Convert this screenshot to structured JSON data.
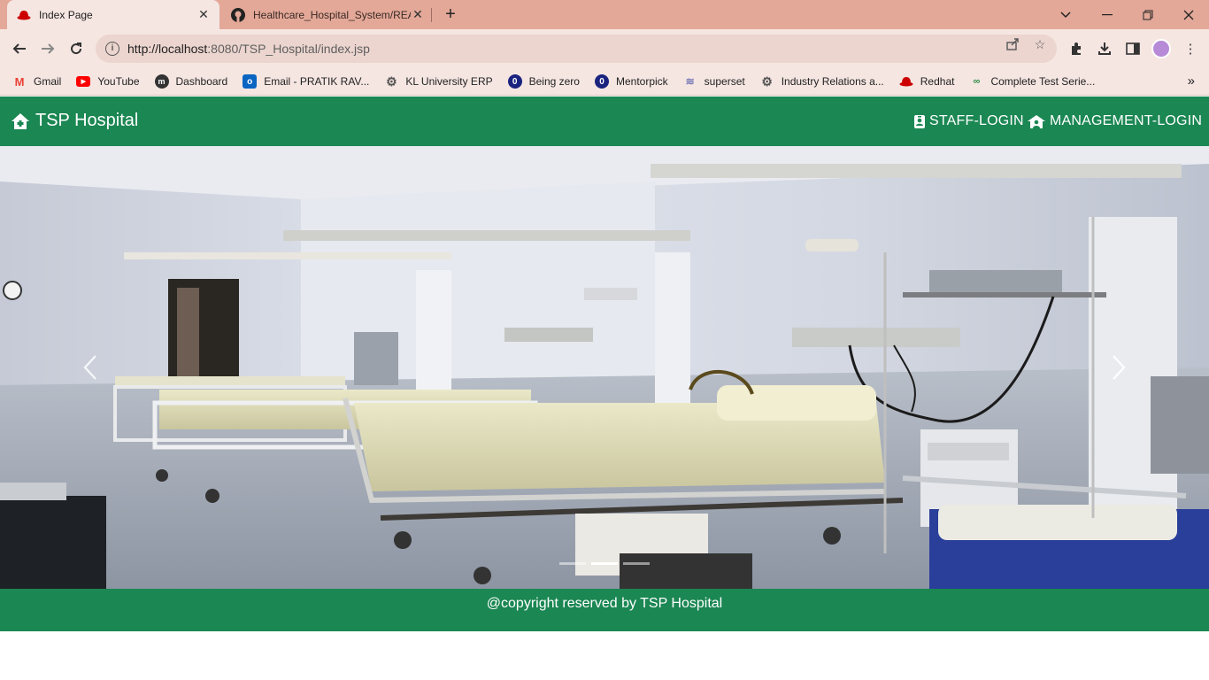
{
  "browser": {
    "tabs": [
      {
        "title": "Index Page",
        "active": true
      },
      {
        "title": "Healthcare_Hospital_System/REA",
        "active": false
      }
    ],
    "url": {
      "host": "http://localhost",
      "rest": ":8080/TSP_Hospital/index.jsp"
    },
    "bookmarks": [
      {
        "label": "Gmail",
        "icon": "gmail-icon",
        "color": "#ea4335"
      },
      {
        "label": "YouTube",
        "icon": "youtube-icon",
        "color": "#ff0000"
      },
      {
        "label": "Dashboard",
        "icon": "dashboard-icon",
        "color": "#333333"
      },
      {
        "label": "Email - PRATIK RAV...",
        "icon": "outlook-icon",
        "color": "#0a64c2"
      },
      {
        "label": "KL University ERP",
        "icon": "gear-icon",
        "color": "#555555"
      },
      {
        "label": "Being zero",
        "icon": "being-zero-icon",
        "color": "#1a237e"
      },
      {
        "label": "Mentorpick",
        "icon": "mentorpick-icon",
        "color": "#1a237e"
      },
      {
        "label": "superset",
        "icon": "superset-icon",
        "color": "#7a7ab8"
      },
      {
        "label": "Industry Relations a...",
        "icon": "gear-icon",
        "color": "#555555"
      },
      {
        "label": "Redhat",
        "icon": "redhat-icon",
        "color": "#cc0000"
      },
      {
        "label": "Complete Test Serie...",
        "icon": "gfg-icon",
        "color": "#2f8d46"
      }
    ]
  },
  "navbar": {
    "brand": "TSP Hospital",
    "links": [
      "STAFF-LOGIN",
      "MANAGEMENT-LOGIN"
    ],
    "color": "#1b8753"
  },
  "carousel": {
    "slide_count": 3,
    "active_index": 1
  },
  "footer": {
    "text": "@copyright reserved by TSP Hospital"
  }
}
